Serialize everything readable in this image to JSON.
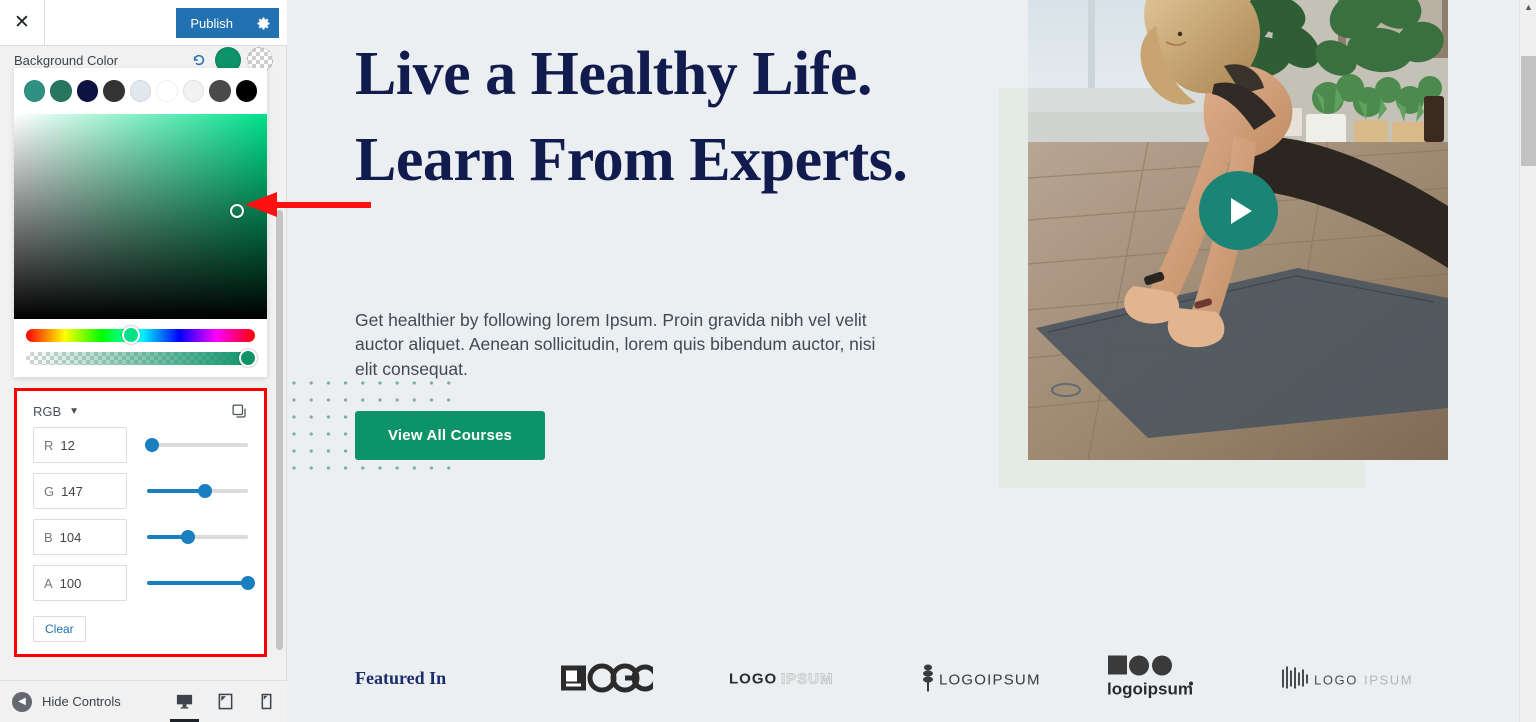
{
  "sidebar": {
    "close_icon": "close-icon",
    "publish_label": "Publish",
    "gear_icon": "gear-icon",
    "control_label": "Background Color",
    "reset_icon": "reset-icon",
    "current_color_hex": "#0c9368",
    "transparent_swatch": "transparent",
    "palette": [
      {
        "name": "teal",
        "hex": "#2f9184"
      },
      {
        "name": "green",
        "hex": "#27765f"
      },
      {
        "name": "navy",
        "hex": "#0c1241"
      },
      {
        "name": "dark-gray",
        "hex": "#333333"
      },
      {
        "name": "light-blue-gray",
        "hex": "#e2e9ee"
      },
      {
        "name": "white",
        "hex": "#ffffff"
      },
      {
        "name": "off-white",
        "hex": "#f2f2f2"
      },
      {
        "name": "charcoal",
        "hex": "#4a4a4a"
      },
      {
        "name": "black",
        "hex": "#000000"
      }
    ],
    "picker": {
      "mode_label": "RGB",
      "chevron_icon": "chevron-down-icon",
      "copy_icon": "copy-icon",
      "channels": [
        {
          "key": "R",
          "label": "R",
          "value": "12",
          "percent": 4.7
        },
        {
          "key": "G",
          "label": "G",
          "value": "147",
          "percent": 57.6
        },
        {
          "key": "B",
          "label": "B",
          "value": "104",
          "percent": 40.8
        },
        {
          "key": "A",
          "label": "A",
          "value": "100",
          "percent": 100
        }
      ],
      "clear_label": "Clear"
    },
    "footer": {
      "hide_controls_label": "Hide Controls",
      "back_icon": "back-arrow-icon",
      "devices": [
        {
          "name": "desktop",
          "icon": "desktop-icon",
          "active": true
        },
        {
          "name": "tablet",
          "icon": "tablet-icon",
          "active": false
        },
        {
          "name": "mobile",
          "icon": "mobile-icon",
          "active": false
        }
      ]
    }
  },
  "preview": {
    "hero": {
      "title": "Live a Healthy Life. Learn From Experts.",
      "subtitle": "Get healthier by following lorem Ipsum. Proin gravida nibh vel velit auctor aliquet. Aenean sollicitudin, lorem quis bibendum auctor, nisi elit consequat.",
      "cta_label": "View All Courses",
      "play_icon": "play-icon",
      "accent_hex": "#0c9368",
      "play_button_hex": "#1a8476",
      "title_color_hex": "#111b4d",
      "backdrop_hex": "#e4ebe6"
    },
    "featured": {
      "label": "Featured In",
      "logos": [
        {
          "name": "logo-logo",
          "text": "LOGO"
        },
        {
          "name": "logo-logoipsum-bold",
          "text": "LOGOIPSUM"
        },
        {
          "name": "logo-logoipsum-wheat",
          "text": "LOGOIPSUM"
        },
        {
          "name": "logo-logoipsum-shapes",
          "text": "logoipsum"
        },
        {
          "name": "logo-logoipsum-bars",
          "text": "LOGOIPSUM"
        }
      ]
    }
  },
  "scrollbars": {
    "up_arrow_icon": "scroll-up-arrow-icon"
  }
}
